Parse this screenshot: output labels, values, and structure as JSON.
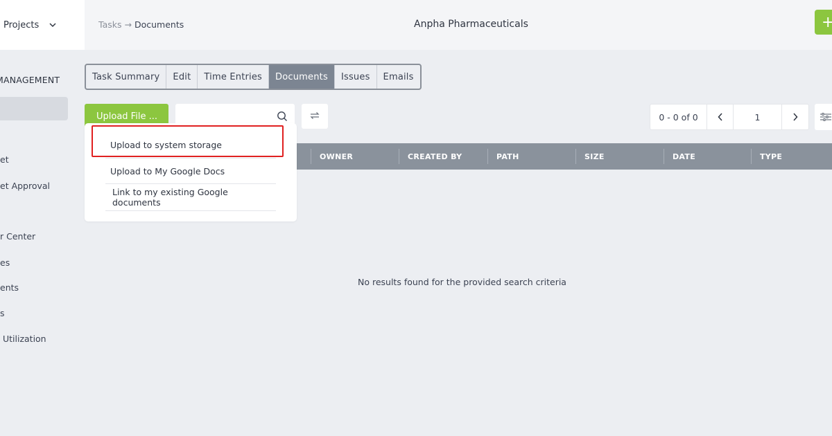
{
  "sidebar": {
    "projects_label": "Projects",
    "section_title": "MANAGEMENT",
    "items": [
      {
        "label": "et"
      },
      {
        "label": "et Approval"
      },
      {
        "label": "r Center"
      },
      {
        "label": "es"
      },
      {
        "label": "ents"
      },
      {
        "label": "s"
      },
      {
        "label": " Utilization"
      }
    ]
  },
  "topbar": {
    "breadcrumb": {
      "parent": "Tasks",
      "arrow": "→",
      "current": "Documents"
    },
    "company": "Anpha Pharmaceuticals",
    "add_label": "+"
  },
  "tabs": [
    {
      "label": "Task Summary",
      "active": false
    },
    {
      "label": "Edit",
      "active": false
    },
    {
      "label": "Time Entries",
      "active": false
    },
    {
      "label": "Documents",
      "active": true
    },
    {
      "label": "Issues",
      "active": false
    },
    {
      "label": "Emails",
      "active": false
    }
  ],
  "toolbar": {
    "upload_label": "Upload File ...",
    "search_placeholder": "",
    "search_value": ""
  },
  "pagination": {
    "range": "0 - 0 of 0",
    "page": "1"
  },
  "table": {
    "columns": [
      "OWNER",
      "CREATED BY",
      "PATH",
      "SIZE",
      "DATE",
      "TYPE"
    ],
    "empty_message": "No results found for the provided search criteria"
  },
  "dropdown": {
    "items": [
      {
        "label": "Upload to system storage"
      },
      {
        "label": "Upload to My Google Docs"
      },
      {
        "label": "Link to my existing Google documents"
      }
    ]
  },
  "colors": {
    "accent_green": "#8cc63f",
    "active_tab": "#7c8592",
    "table_header": "#8a929c",
    "highlight": "#e02020"
  }
}
